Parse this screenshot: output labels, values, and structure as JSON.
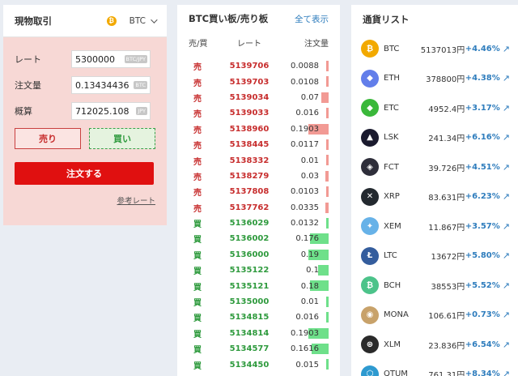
{
  "trade": {
    "title": "現物取引",
    "coin": "BTC",
    "coin_icon_letter": "₿",
    "fields": [
      {
        "label": "レート",
        "value": "5300000",
        "unit": "BTC/JPY"
      },
      {
        "label": "注文量",
        "value": "0.13434436",
        "unit": "BTC"
      },
      {
        "label": "概算",
        "value": "712025.108",
        "unit": "JPY"
      }
    ],
    "sell_label": "売り",
    "buy_label": "買い",
    "order_label": "注文する",
    "ref_rate_label": "参考レート"
  },
  "orderbook": {
    "title": "BTC買い板/売り板",
    "show_all": "全て表示",
    "col_side": "売/買",
    "col_rate": "レート",
    "col_qty": "注文量",
    "sell_label": "売",
    "buy_label": "買",
    "rows": [
      {
        "side": "sell",
        "rate": "5139706",
        "qty": "0.0088",
        "depth": 0.04
      },
      {
        "side": "sell",
        "rate": "5139703",
        "qty": "0.0108",
        "depth": 0.05
      },
      {
        "side": "sell",
        "rate": "5139034",
        "qty": "0.07",
        "depth": 0.3
      },
      {
        "side": "sell",
        "rate": "5139033",
        "qty": "0.016",
        "depth": 0.07
      },
      {
        "side": "sell",
        "rate": "5138960",
        "qty": "0.1903",
        "depth": 0.82
      },
      {
        "side": "sell",
        "rate": "5138445",
        "qty": "0.0117",
        "depth": 0.05
      },
      {
        "side": "sell",
        "rate": "5138332",
        "qty": "0.01",
        "depth": 0.04
      },
      {
        "side": "sell",
        "rate": "5138279",
        "qty": "0.03",
        "depth": 0.13
      },
      {
        "side": "sell",
        "rate": "5137808",
        "qty": "0.0103",
        "depth": 0.04
      },
      {
        "side": "sell",
        "rate": "5137762",
        "qty": "0.0335",
        "depth": 0.14
      },
      {
        "side": "buy",
        "rate": "5136029",
        "qty": "0.0132",
        "depth": 0.06
      },
      {
        "side": "buy",
        "rate": "5136002",
        "qty": "0.176",
        "depth": 0.76
      },
      {
        "side": "buy",
        "rate": "5136000",
        "qty": "0.19",
        "depth": 0.82
      },
      {
        "side": "buy",
        "rate": "5135122",
        "qty": "0.1",
        "depth": 0.43
      },
      {
        "side": "buy",
        "rate": "5135121",
        "qty": "0.18",
        "depth": 0.78
      },
      {
        "side": "buy",
        "rate": "5135000",
        "qty": "0.01",
        "depth": 0.04
      },
      {
        "side": "buy",
        "rate": "5134815",
        "qty": "0.016",
        "depth": 0.07
      },
      {
        "side": "buy",
        "rate": "5134814",
        "qty": "0.1903",
        "depth": 0.82
      },
      {
        "side": "buy",
        "rate": "5134577",
        "qty": "0.1616",
        "depth": 0.7
      },
      {
        "side": "buy",
        "rate": "5134450",
        "qty": "0.015",
        "depth": 0.06
      }
    ]
  },
  "coinlist": {
    "title": "通貨リスト",
    "arrow": "↗",
    "coins": [
      {
        "sym": "BTC",
        "price": "5137013円",
        "chg": "+4.46%",
        "icon": "bitcoin-icon",
        "glyph": "₿",
        "color": "#f2a900"
      },
      {
        "sym": "ETH",
        "price": "378800円",
        "chg": "+4.38%",
        "icon": "ethereum-icon",
        "glyph": "◆",
        "color": "#627eea"
      },
      {
        "sym": "ETC",
        "price": "4952.4円",
        "chg": "+3.17%",
        "icon": "ethereum-classic-icon",
        "glyph": "◆",
        "color": "#3ab83a"
      },
      {
        "sym": "LSK",
        "price": "241.34円",
        "chg": "+6.16%",
        "icon": "lisk-icon",
        "glyph": "▲",
        "color": "#1a1a2e"
      },
      {
        "sym": "FCT",
        "price": "39.726円",
        "chg": "+4.51%",
        "icon": "factom-icon",
        "glyph": "◈",
        "color": "#2e2e3a"
      },
      {
        "sym": "XRP",
        "price": "83.631円",
        "chg": "+6.23%",
        "icon": "ripple-icon",
        "glyph": "✕",
        "color": "#23292f"
      },
      {
        "sym": "XEM",
        "price": "11.867円",
        "chg": "+3.57%",
        "icon": "nem-icon",
        "glyph": "✦",
        "color": "#67b2e8"
      },
      {
        "sym": "LTC",
        "price": "13672円",
        "chg": "+5.80%",
        "icon": "litecoin-icon",
        "glyph": "Ł",
        "color": "#345d9d"
      },
      {
        "sym": "BCH",
        "price": "38553円",
        "chg": "+5.52%",
        "icon": "bitcoin-cash-icon",
        "glyph": "₿",
        "color": "#4cc38a"
      },
      {
        "sym": "MONA",
        "price": "106.61円",
        "chg": "+0.73%",
        "icon": "monacoin-icon",
        "glyph": "◉",
        "color": "#c8a26a"
      },
      {
        "sym": "XLM",
        "price": "23.836円",
        "chg": "+6.54%",
        "icon": "stellar-icon",
        "glyph": "⊛",
        "color": "#2a2a2a"
      },
      {
        "sym": "QTUM",
        "price": "761.31円",
        "chg": "+8.34%",
        "icon": "qtum-icon",
        "glyph": "⬡",
        "color": "#2e9ad0"
      }
    ]
  }
}
